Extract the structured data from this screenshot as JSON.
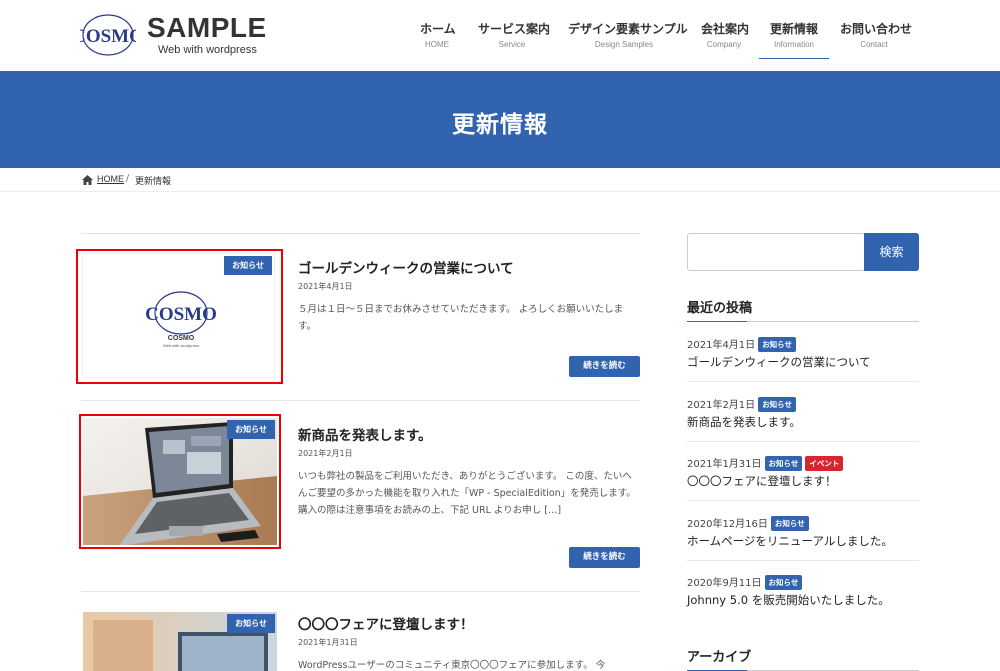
{
  "brand": {
    "logo_text": "COSMO",
    "title": "SAMPLE",
    "subtitle": "Web with wordpress"
  },
  "nav": [
    {
      "jp": "ホーム",
      "en": "HOME"
    },
    {
      "jp": "サービス案内",
      "en": "Service"
    },
    {
      "jp": "デザイン要素サンプル",
      "en": "Design Samples"
    },
    {
      "jp": "会社案内",
      "en": "Company"
    },
    {
      "jp": "更新情報",
      "en": "Information"
    },
    {
      "jp": "お問い合わせ",
      "en": "Contact"
    }
  ],
  "nav_active_index": 4,
  "page_title": "更新情報",
  "breadcrumb": {
    "home": "HOME",
    "separator": "/",
    "current": "更新情報"
  },
  "posts": [
    {
      "badge": "お知らせ",
      "title": "ゴールデンウィークの営業について",
      "date": "2021年4月1日",
      "excerpt": "５月は１日～５日までお休みさせていただきます。 よろしくお願いいたします。",
      "read_more": "続きを読む",
      "thumb": "cosmo-logo",
      "thumb_logo_text": "COSMO",
      "thumb_logo_caption": "COSMO",
      "thumb_logo_subcaption": "Web with wordpress"
    },
    {
      "badge": "お知らせ",
      "title": "新商品を発表します。",
      "date": "2021年2月1日",
      "excerpt": "いつも弊社の製品をご利用いただき、ありがとうございます。 この度、たいへんご要望の多かった機能を取り入れた「WP - SpecialEdition」を発売します。 購入の際は注意事項をお読みの上、下記 URL よりお申し […]",
      "read_more": "続きを読む",
      "thumb": "laptop-photo"
    },
    {
      "badge": "お知らせ",
      "title": "〇〇〇フェアに登壇します！",
      "date": "2021年1月31日",
      "excerpt": "WordPressユーザーのコミュニティ東京〇〇〇フェアに参加します。 今",
      "thumb": "office-photo"
    }
  ],
  "sidebar": {
    "search_button": "検索",
    "search_value": "",
    "recent_heading": "最近の投稿",
    "recent": [
      {
        "date": "2021年4月1日",
        "badges": [
          {
            "label": "お知らせ",
            "color": "#3263ae"
          }
        ],
        "title": "ゴールデンウィークの営業について"
      },
      {
        "date": "2021年2月1日",
        "badges": [
          {
            "label": "お知らせ",
            "color": "#3263ae"
          }
        ],
        "title": "新商品を発表します。"
      },
      {
        "date": "2021年1月31日",
        "badges": [
          {
            "label": "お知らせ",
            "color": "#3263ae"
          },
          {
            "label": "イベント",
            "color": "#d9262e"
          }
        ],
        "title": "〇〇〇フェアに登壇します！"
      },
      {
        "date": "2020年12月16日",
        "badges": [
          {
            "label": "お知らせ",
            "color": "#3263ae"
          }
        ],
        "title": "ホームページをリニューアルしました。"
      },
      {
        "date": "2020年9月11日",
        "badges": [
          {
            "label": "お知らせ",
            "color": "#3263ae"
          }
        ],
        "title": "Johnny 5.0 を販売開始いたしました。"
      }
    ],
    "archive_heading": "アーカイブ"
  },
  "colors": {
    "accent": "#3263ae",
    "event": "#d9262e",
    "highlight_frame": "#e00000"
  }
}
